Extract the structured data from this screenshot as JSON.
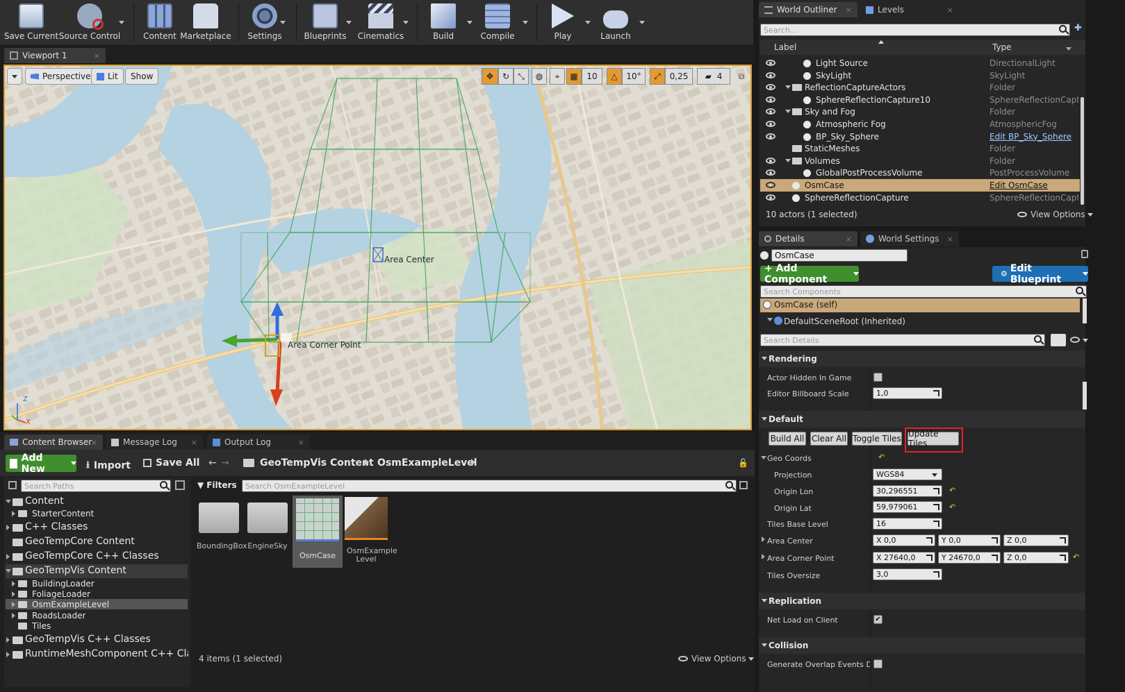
{
  "toolbar": {
    "buttons": [
      {
        "label": "Save Current",
        "icon": "save-icon"
      },
      {
        "label": "Source Control",
        "icon": "source-control-icon"
      },
      {
        "label": "Content",
        "icon": "content-icon"
      },
      {
        "label": "Marketplace",
        "icon": "marketplace-icon"
      },
      {
        "label": "Settings",
        "icon": "settings-gears-icon"
      },
      {
        "label": "Blueprints",
        "icon": "blueprints-icon"
      },
      {
        "label": "Cinematics",
        "icon": "clapper-icon"
      },
      {
        "label": "Build",
        "icon": "build-icon"
      },
      {
        "label": "Compile",
        "icon": "compile-icon"
      },
      {
        "label": "Play",
        "icon": "play-icon"
      },
      {
        "label": "Launch",
        "icon": "gamepad-icon"
      }
    ]
  },
  "viewport": {
    "tab": "Viewport 1",
    "perspective": "Perspective",
    "lit": "Lit",
    "show": "Show",
    "grid_snap": "10",
    "rot_snap": "10°",
    "scale_snap": "0,25",
    "cam_speed": "4",
    "labels": {
      "area_center": "Area Center",
      "area_corner": "Area Corner Point"
    },
    "axis": {
      "z": "Z",
      "x": "X"
    }
  },
  "outliner": {
    "tabs": [
      "World Outliner",
      "Levels"
    ],
    "search_placeholder": "Search...",
    "col_label": "Label",
    "col_type": "Type",
    "rows": [
      {
        "name": "Light Source",
        "type": "DirectionalLight",
        "link": false
      },
      {
        "name": "SkyLight",
        "type": "SkyLight",
        "link": false
      },
      {
        "name": "ReflectionCaptureActors",
        "type": "Folder",
        "link": false
      },
      {
        "name": "SphereReflectionCapture10",
        "type": "SphereReflectionCapture",
        "link": false
      },
      {
        "name": "Sky and Fog",
        "type": "Folder",
        "link": false
      },
      {
        "name": "Atmospheric Fog",
        "type": "AtmosphericFog",
        "link": false
      },
      {
        "name": "BP_Sky_Sphere",
        "type": "Edit BP_Sky_Sphere",
        "link": true
      },
      {
        "name": "StaticMeshes",
        "type": "Folder",
        "link": false
      },
      {
        "name": "Volumes",
        "type": "Folder",
        "link": false
      },
      {
        "name": "GlobalPostProcessVolume",
        "type": "PostProcessVolume",
        "link": false
      },
      {
        "name": "OsmCase",
        "type": "Edit OsmCase",
        "link": true
      },
      {
        "name": "SphereReflectionCapture",
        "type": "SphereReflectionCapture",
        "link": false
      }
    ],
    "status": "10 actors (1 selected)",
    "view_options": "View Options"
  },
  "details": {
    "tabs": [
      "Details",
      "World Settings"
    ],
    "name_value": "OsmCase",
    "add_component": "+ Add Component",
    "edit_blueprint": "Edit Blueprint",
    "search_components": "Search Components",
    "component_self": "OsmCase (self)",
    "component_root": "DefaultSceneRoot (Inherited)",
    "search_details": "Search Details",
    "rendering": {
      "header": "Rendering",
      "hidden_label": "Actor Hidden In Game",
      "billboard_label": "Editor Billboard Scale",
      "billboard_value": "1,0"
    },
    "default": {
      "header": "Default",
      "buttons": [
        "Build All",
        "Clear All",
        "Toggle Tiles",
        "Update Tiles"
      ],
      "geo_coords": "Geo Coords",
      "projection_label": "Projection",
      "projection_value": "WGS84",
      "origin_lon_label": "Origin Lon",
      "origin_lon_value": "30,296551",
      "origin_lat_label": "Origin Lat",
      "origin_lat_value": "59,979061",
      "tiles_base_label": "Tiles Base Level",
      "tiles_base_value": "16",
      "area_center_label": "Area Center",
      "area_center": {
        "x": "X  0,0",
        "y": "Y  0,0",
        "z": "Z  0,0"
      },
      "area_corner_label": "Area Corner Point",
      "area_corner": {
        "x": "X  27640,0",
        "y": "Y  24670,0",
        "z": "Z  0,0"
      },
      "tiles_oversize_label": "Tiles Oversize",
      "tiles_oversize_value": "3,0"
    },
    "replication": {
      "header": "Replication",
      "net_load_label": "Net Load on Client"
    },
    "collision": {
      "header": "Collision",
      "overlap_label": "Generate Overlap Events Durin"
    }
  },
  "bottom_tabs": [
    "Content Browser",
    "Message Log",
    "Output Log"
  ],
  "content_browser": {
    "add_new": "Add New",
    "import": "Import",
    "save_all": "Save All",
    "path": [
      "GeoTempVis Content",
      "OsmExampleLevel"
    ],
    "search_paths": "Search Paths",
    "filters": "Filters",
    "search_assets": "Search OsmExampleLevel",
    "tree": [
      {
        "label": "Content",
        "level": 0
      },
      {
        "label": "StarterContent",
        "level": 1
      },
      {
        "label": "C++ Classes",
        "level": 0
      },
      {
        "label": "GeoTempCore Content",
        "level": 0
      },
      {
        "label": "GeoTempCore C++ Classes",
        "level": 0
      },
      {
        "label": "GeoTempVis Content",
        "level": 0
      },
      {
        "label": "BuildingLoader",
        "level": 1
      },
      {
        "label": "FoliageLoader",
        "level": 1
      },
      {
        "label": "OsmExampleLevel",
        "level": 1
      },
      {
        "label": "RoadsLoader",
        "level": 1
      },
      {
        "label": "Tiles",
        "level": 1
      },
      {
        "label": "GeoTempVis C++ Classes",
        "level": 0
      },
      {
        "label": "RuntimeMeshComponent C++ Cla:",
        "level": 0
      }
    ],
    "assets": [
      "BoundingBox",
      "EngineSky",
      "OsmCase",
      "OsmExample Level"
    ],
    "status": "4 items (1 selected)",
    "view_options": "View Options"
  },
  "colors": {
    "accent_orange": "#d79b2b",
    "highlight_red": "#e0242b",
    "green_btn": "#3f8f2f",
    "blue_btn": "#1f6fb5",
    "selected_row": "#c9a87a"
  }
}
